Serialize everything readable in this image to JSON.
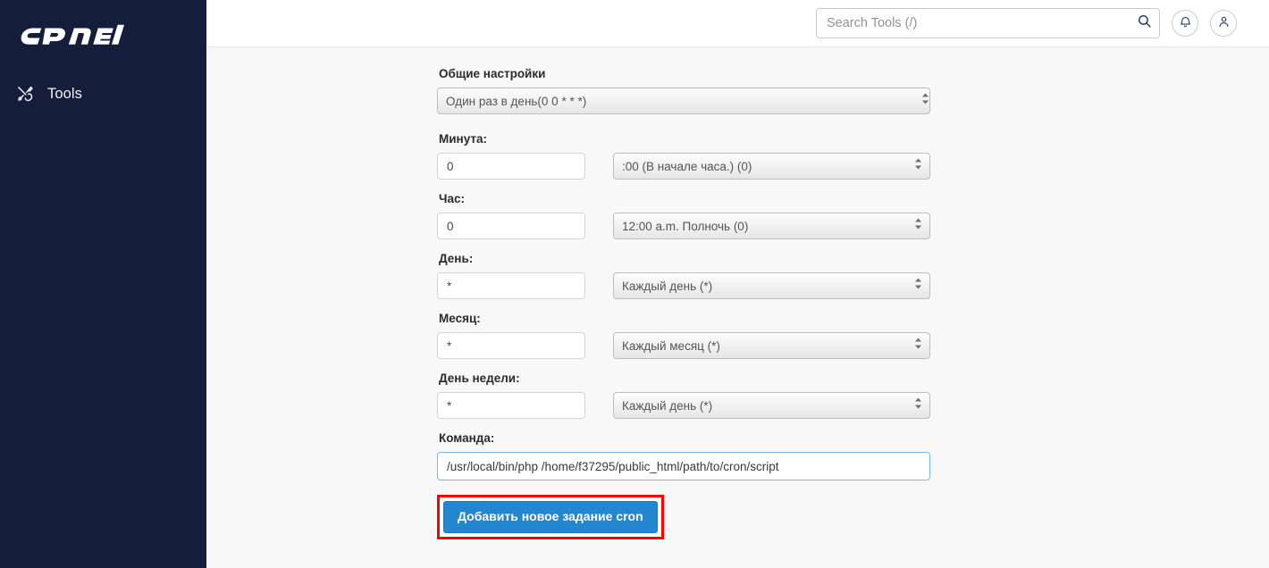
{
  "sidebar": {
    "logo_text": "cPanel",
    "logo_icon": "cpanel-logo",
    "items": [
      {
        "label": "Tools",
        "icon": "tools-icon"
      }
    ]
  },
  "header": {
    "search": {
      "placeholder": "Search Tools (/)",
      "value": "",
      "icon": "search-icon"
    },
    "notifications_icon": "bell-icon",
    "account_icon": "user-icon"
  },
  "form": {
    "general_settings": {
      "label": "Общие настройки",
      "selected": "Один раз в день(0 0 * * *)"
    },
    "fields": [
      {
        "label": "Минута:",
        "text_value": "0",
        "select_value": ":00 (В начале часа.) (0)"
      },
      {
        "label": "Час:",
        "text_value": "0",
        "select_value": "12:00 a.m. Полночь (0)"
      },
      {
        "label": "День:",
        "text_value": "*",
        "select_value": "Каждый день (*)"
      },
      {
        "label": "Месяц:",
        "text_value": "*",
        "select_value": "Каждый месяц (*)"
      },
      {
        "label": "День недели:",
        "text_value": "*",
        "select_value": "Каждый день (*)"
      }
    ],
    "command": {
      "label": "Команда:",
      "value": "/usr/local/bin/php /home/f37295/public_html/path/to/cron/script"
    },
    "submit_label": "Добавить новое задание cron"
  },
  "colors": {
    "sidebar_bg": "#141d3a",
    "button_blue": "#2287ce",
    "highlight_red": "#fe0000",
    "focus_border": "#76b9e6",
    "content_bg": "#f8f8f8"
  }
}
